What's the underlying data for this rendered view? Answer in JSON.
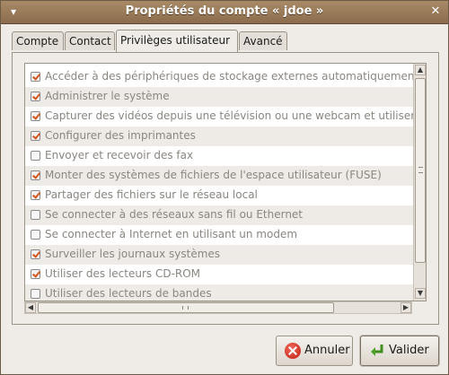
{
  "window": {
    "title": "Propriétés du compte « jdoe »",
    "menu_icon": "window-menu-icon",
    "close_icon": "close-icon"
  },
  "tabs": [
    {
      "label": "Compte",
      "active": false
    },
    {
      "label": "Contact",
      "active": false
    },
    {
      "label": "Privilèges utilisateur",
      "active": true
    },
    {
      "label": "Avancé",
      "active": false
    }
  ],
  "privileges": [
    {
      "label": "Accéder à des périphériques de stockage externes automatiquement",
      "checked": true
    },
    {
      "label": "Administrer le système",
      "checked": true
    },
    {
      "label": "Capturer des vidéos depuis une télévision ou une webcam et utiliser",
      "checked": true
    },
    {
      "label": "Configurer des imprimantes",
      "checked": true
    },
    {
      "label": "Envoyer et recevoir des fax",
      "checked": false
    },
    {
      "label": "Monter des systèmes de fichiers de l'espace utilisateur (FUSE)",
      "checked": true
    },
    {
      "label": "Partager des fichiers sur le réseau local",
      "checked": true
    },
    {
      "label": "Se connecter à des réseaux sans fil ou Ethernet",
      "checked": false
    },
    {
      "label": "Se connecter à Internet en utilisant un modem",
      "checked": false
    },
    {
      "label": "Surveiller les journaux systèmes",
      "checked": true
    },
    {
      "label": "Utiliser des lecteurs CD-ROM",
      "checked": true
    },
    {
      "label": "Utiliser des lecteurs de bandes",
      "checked": false
    }
  ],
  "buttons": {
    "cancel_label": "Annuler",
    "ok_label": "Valider"
  },
  "colors": {
    "accent_check": "#d4541b",
    "titlebar": "#8b6c4c"
  }
}
